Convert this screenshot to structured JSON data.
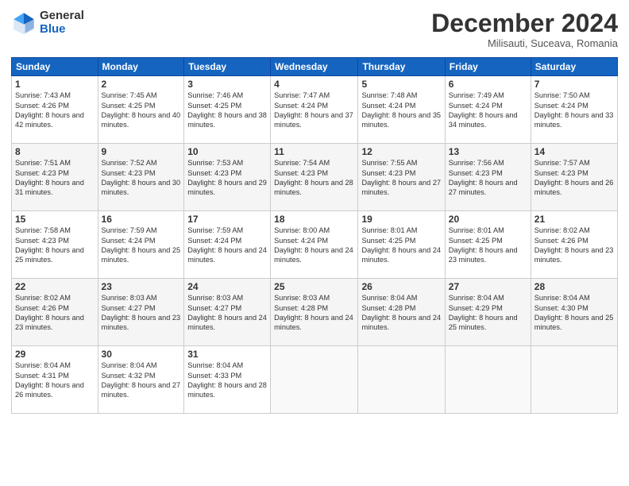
{
  "logo": {
    "general": "General",
    "blue": "Blue"
  },
  "header": {
    "month": "December 2024",
    "location": "Milisauti, Suceava, Romania"
  },
  "days_of_week": [
    "Sunday",
    "Monday",
    "Tuesday",
    "Wednesday",
    "Thursday",
    "Friday",
    "Saturday"
  ],
  "weeks": [
    [
      {
        "day": "1",
        "sunrise": "7:43 AM",
        "sunset": "4:26 PM",
        "daylight": "8 hours and 42 minutes."
      },
      {
        "day": "2",
        "sunrise": "7:45 AM",
        "sunset": "4:25 PM",
        "daylight": "8 hours and 40 minutes."
      },
      {
        "day": "3",
        "sunrise": "7:46 AM",
        "sunset": "4:25 PM",
        "daylight": "8 hours and 38 minutes."
      },
      {
        "day": "4",
        "sunrise": "7:47 AM",
        "sunset": "4:24 PM",
        "daylight": "8 hours and 37 minutes."
      },
      {
        "day": "5",
        "sunrise": "7:48 AM",
        "sunset": "4:24 PM",
        "daylight": "8 hours and 35 minutes."
      },
      {
        "day": "6",
        "sunrise": "7:49 AM",
        "sunset": "4:24 PM",
        "daylight": "8 hours and 34 minutes."
      },
      {
        "day": "7",
        "sunrise": "7:50 AM",
        "sunset": "4:24 PM",
        "daylight": "8 hours and 33 minutes."
      }
    ],
    [
      {
        "day": "8",
        "sunrise": "7:51 AM",
        "sunset": "4:23 PM",
        "daylight": "8 hours and 31 minutes."
      },
      {
        "day": "9",
        "sunrise": "7:52 AM",
        "sunset": "4:23 PM",
        "daylight": "8 hours and 30 minutes."
      },
      {
        "day": "10",
        "sunrise": "7:53 AM",
        "sunset": "4:23 PM",
        "daylight": "8 hours and 29 minutes."
      },
      {
        "day": "11",
        "sunrise": "7:54 AM",
        "sunset": "4:23 PM",
        "daylight": "8 hours and 28 minutes."
      },
      {
        "day": "12",
        "sunrise": "7:55 AM",
        "sunset": "4:23 PM",
        "daylight": "8 hours and 27 minutes."
      },
      {
        "day": "13",
        "sunrise": "7:56 AM",
        "sunset": "4:23 PM",
        "daylight": "8 hours and 27 minutes."
      },
      {
        "day": "14",
        "sunrise": "7:57 AM",
        "sunset": "4:23 PM",
        "daylight": "8 hours and 26 minutes."
      }
    ],
    [
      {
        "day": "15",
        "sunrise": "7:58 AM",
        "sunset": "4:23 PM",
        "daylight": "8 hours and 25 minutes."
      },
      {
        "day": "16",
        "sunrise": "7:59 AM",
        "sunset": "4:24 PM",
        "daylight": "8 hours and 25 minutes."
      },
      {
        "day": "17",
        "sunrise": "7:59 AM",
        "sunset": "4:24 PM",
        "daylight": "8 hours and 24 minutes."
      },
      {
        "day": "18",
        "sunrise": "8:00 AM",
        "sunset": "4:24 PM",
        "daylight": "8 hours and 24 minutes."
      },
      {
        "day": "19",
        "sunrise": "8:01 AM",
        "sunset": "4:25 PM",
        "daylight": "8 hours and 24 minutes."
      },
      {
        "day": "20",
        "sunrise": "8:01 AM",
        "sunset": "4:25 PM",
        "daylight": "8 hours and 23 minutes."
      },
      {
        "day": "21",
        "sunrise": "8:02 AM",
        "sunset": "4:26 PM",
        "daylight": "8 hours and 23 minutes."
      }
    ],
    [
      {
        "day": "22",
        "sunrise": "8:02 AM",
        "sunset": "4:26 PM",
        "daylight": "8 hours and 23 minutes."
      },
      {
        "day": "23",
        "sunrise": "8:03 AM",
        "sunset": "4:27 PM",
        "daylight": "8 hours and 23 minutes."
      },
      {
        "day": "24",
        "sunrise": "8:03 AM",
        "sunset": "4:27 PM",
        "daylight": "8 hours and 24 minutes."
      },
      {
        "day": "25",
        "sunrise": "8:03 AM",
        "sunset": "4:28 PM",
        "daylight": "8 hours and 24 minutes."
      },
      {
        "day": "26",
        "sunrise": "8:04 AM",
        "sunset": "4:28 PM",
        "daylight": "8 hours and 24 minutes."
      },
      {
        "day": "27",
        "sunrise": "8:04 AM",
        "sunset": "4:29 PM",
        "daylight": "8 hours and 25 minutes."
      },
      {
        "day": "28",
        "sunrise": "8:04 AM",
        "sunset": "4:30 PM",
        "daylight": "8 hours and 25 minutes."
      }
    ],
    [
      {
        "day": "29",
        "sunrise": "8:04 AM",
        "sunset": "4:31 PM",
        "daylight": "8 hours and 26 minutes."
      },
      {
        "day": "30",
        "sunrise": "8:04 AM",
        "sunset": "4:32 PM",
        "daylight": "8 hours and 27 minutes."
      },
      {
        "day": "31",
        "sunrise": "8:04 AM",
        "sunset": "4:33 PM",
        "daylight": "8 hours and 28 minutes."
      },
      null,
      null,
      null,
      null
    ]
  ],
  "labels": {
    "sunrise": "Sunrise:",
    "sunset": "Sunset:",
    "daylight": "Daylight:"
  }
}
